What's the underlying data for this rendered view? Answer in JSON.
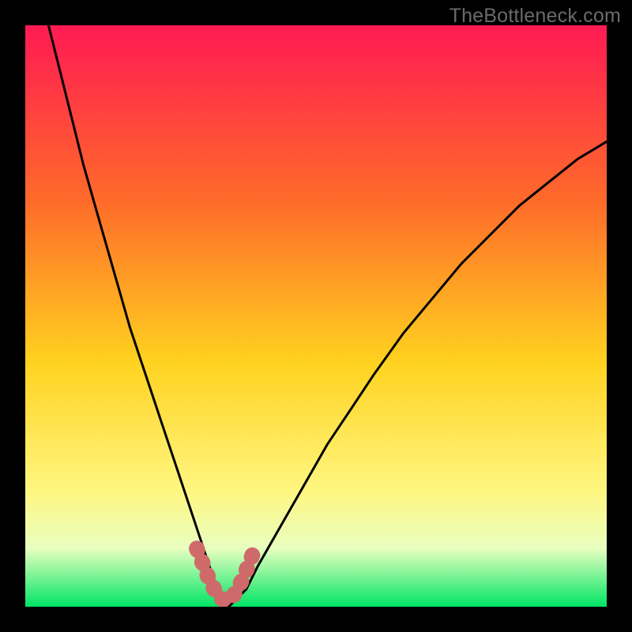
{
  "watermark": "TheBottleneck.com",
  "colors": {
    "frame": "#000000",
    "gradient_top": "#ff1a53",
    "gradient_mid1": "#ff6a2a",
    "gradient_mid2": "#ffd21f",
    "gradient_mid3": "#fff680",
    "gradient_bottom_band": "#e8ffc0",
    "gradient_green": "#00e565",
    "curve": "#000000",
    "markers": "#cf6a6a"
  },
  "chart_data": {
    "type": "line",
    "title": "",
    "xlabel": "",
    "ylabel": "",
    "xlim": [
      0,
      100
    ],
    "ylim": [
      0,
      100
    ],
    "series": [
      {
        "name": "bottleneck-curve",
        "x": [
          4,
          6,
          8,
          10,
          12,
          14,
          16,
          18,
          20,
          22,
          24,
          26,
          28,
          30,
          32,
          33,
          34,
          35,
          36,
          38,
          40,
          44,
          48,
          52,
          56,
          60,
          65,
          70,
          75,
          80,
          85,
          90,
          95,
          100
        ],
        "values": [
          100,
          92,
          84,
          76,
          69,
          62,
          55,
          48,
          42,
          36,
          30,
          24,
          18,
          12,
          6,
          3,
          1,
          0,
          1,
          3,
          7,
          14,
          21,
          28,
          34,
          40,
          47,
          53,
          59,
          64,
          69,
          73,
          77,
          80
        ]
      }
    ],
    "markers": {
      "name": "low-bottleneck-zone",
      "x": [
        29.5,
        30.5,
        31.5,
        32.5,
        33.5,
        34.5,
        35.5,
        36.5,
        37.5,
        38.5,
        39.5
      ],
      "values": [
        10,
        7.5,
        5,
        3,
        1.5,
        1,
        1.5,
        3,
        5,
        7.5,
        10
      ]
    }
  }
}
